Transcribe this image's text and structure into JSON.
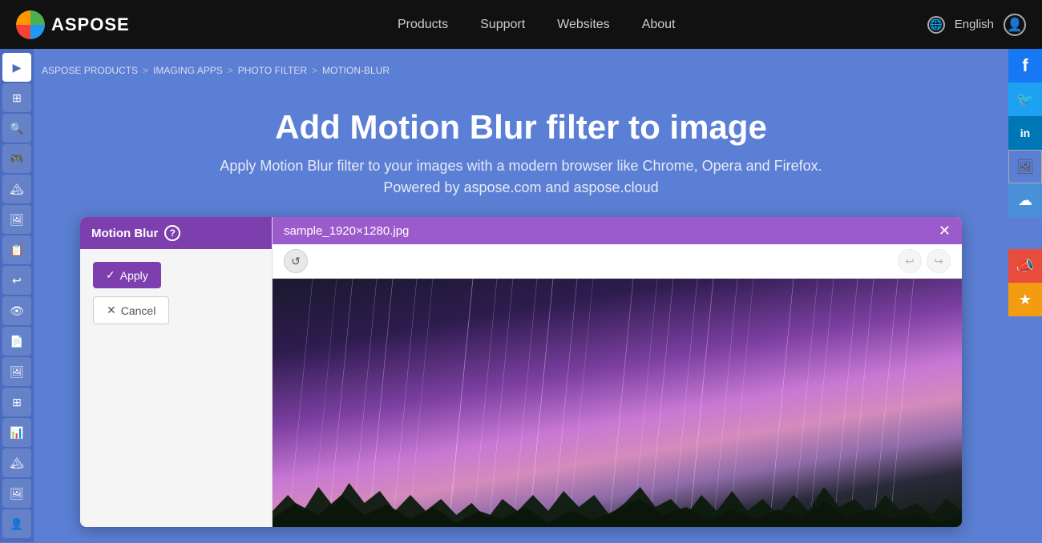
{
  "navbar": {
    "brand": "ASPOSE",
    "links": [
      {
        "label": "Products",
        "href": "#"
      },
      {
        "label": "Support",
        "href": "#"
      },
      {
        "label": "Websites",
        "href": "#"
      },
      {
        "label": "About",
        "href": "#"
      }
    ],
    "language": "English",
    "language_icon": "🌐"
  },
  "breadcrumb": {
    "items": [
      {
        "label": "ASPOSE PRODUCTS",
        "href": "#"
      },
      {
        "label": "IMAGING APPS",
        "href": "#"
      },
      {
        "label": "PHOTO FILTER",
        "href": "#"
      },
      {
        "label": "MOTION-BLUR",
        "href": "#"
      }
    ],
    "separators": [
      ">",
      ">",
      ">"
    ]
  },
  "hero": {
    "title": "Add Motion Blur filter to image",
    "subtitle": "Apply Motion Blur filter to your images with a modern browser like Chrome, Opera and Firefox.",
    "powered_by": "Powered by aspose.com and aspose.cloud"
  },
  "editor": {
    "filter_tab_label": "Motion Blur",
    "help_icon_label": "?",
    "apply_button": "Apply",
    "cancel_button": "Cancel",
    "filename": "sample_1920×1280.jpg",
    "close_icon": "✕",
    "undo_icon": "↩",
    "redo_icon": "↪",
    "rotate_left_icon": "↺",
    "checkmark": "✓",
    "cross": "✕"
  },
  "sidebar_tools": [
    {
      "icon": "▶",
      "name": "expand"
    },
    {
      "icon": "⊞",
      "name": "grid"
    },
    {
      "icon": "🔍",
      "name": "zoom"
    },
    {
      "icon": "🎮",
      "name": "controls"
    },
    {
      "icon": "🏔",
      "name": "landscape"
    },
    {
      "icon": "🖼",
      "name": "frame"
    },
    {
      "icon": "📋",
      "name": "clipboard"
    },
    {
      "icon": "↩",
      "name": "undo"
    },
    {
      "icon": "👁",
      "name": "view"
    },
    {
      "icon": "📄",
      "name": "document"
    },
    {
      "icon": "🖼",
      "name": "image2"
    },
    {
      "icon": "⊞",
      "name": "grid2"
    },
    {
      "icon": "📊",
      "name": "chart"
    },
    {
      "icon": "🏔",
      "name": "landscape2"
    },
    {
      "icon": "🖼",
      "name": "frame2"
    },
    {
      "icon": "👤",
      "name": "user"
    }
  ],
  "social_links": [
    {
      "icon": "f",
      "label": "Facebook",
      "class": "social-fb"
    },
    {
      "icon": "🐦",
      "label": "Twitter",
      "class": "social-tw"
    },
    {
      "icon": "in",
      "label": "LinkedIn",
      "class": "social-li"
    },
    {
      "icon": "🖼",
      "label": "Image Share",
      "class": "social-img"
    },
    {
      "icon": "☁",
      "label": "Cloud",
      "class": "social-cloud"
    },
    {
      "icon": "📣",
      "label": "Notify",
      "class": "social-notify"
    },
    {
      "icon": "★",
      "label": "Star",
      "class": "social-star"
    }
  ],
  "colors": {
    "navbar_bg": "#111111",
    "page_bg": "#5b7fd4",
    "sidebar_bg": "#4a6bbf",
    "filter_tab_bg": "#7c3fad",
    "image_header_bg": "#9c5bca",
    "apply_btn_bg": "#7c3fad"
  }
}
